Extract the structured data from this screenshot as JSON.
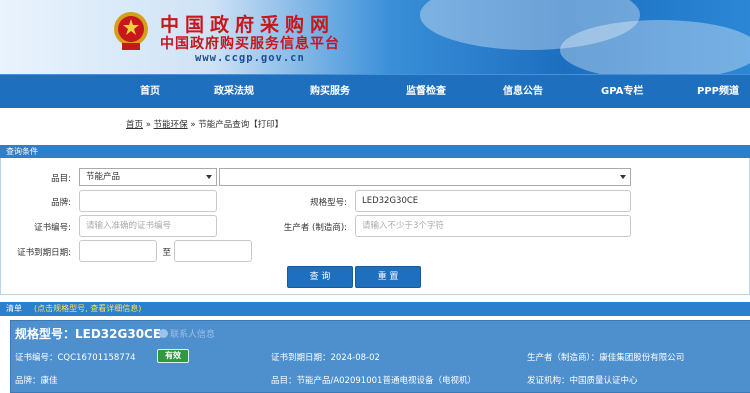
{
  "header": {
    "title_cn": "中国政府采购网",
    "subtitle_cn": "中国政府购买服务信息平台",
    "url": "www.ccgp.gov.cn"
  },
  "nav": {
    "items": [
      "首页",
      "政采法规",
      "购买服务",
      "监督检查",
      "信息公告",
      "GPA专栏",
      "PPP频道"
    ]
  },
  "breadcrumb": {
    "home": "首页",
    "sep1": " » ",
    "section": "节能环保",
    "sep2": " » ",
    "current": "节能产品查询",
    "print": "【打印】"
  },
  "query": {
    "section_title": "查询条件",
    "category_label": "品目:",
    "category_value": "节能产品",
    "brand_label": "品牌:",
    "brand_value": "",
    "model_label": "规格型号:",
    "model_value": "LED32G30CE",
    "cert_label": "证书编号:",
    "cert_placeholder": "请输入准确的证书编号",
    "maker_label": "生产者 (制造商):",
    "maker_placeholder": "请输入不少于3个字符",
    "expiry_label": "证书到期日期:",
    "to_label": "至",
    "search_button": "查 询",
    "reset_button": "重 置"
  },
  "results": {
    "section_title": "清单",
    "note": "(点击规格型号, 查看详细信息)",
    "items": [
      {
        "model_title": "规格型号：LED32G30CE",
        "contact": "联系人信息",
        "cert_no": "证书编号：CQC16701158774",
        "status": "有效",
        "expiry": "证书到期日期：2024-08-02",
        "maker": "生产者（制造商）：康佳集团股份有限公司",
        "brand": "品牌：康佳",
        "category": "品目：节能产品/A02091001普通电视设备（电视机）",
        "issuer": "发证机构：中国质量认证中心"
      }
    ]
  },
  "colors": {
    "nav_bg": "#1f6fbf",
    "section_bar": "#2c7fcd",
    "card_bg": "#4e8fce",
    "status_green": "#2e9a3e",
    "logo_red": "#c8161d"
  }
}
